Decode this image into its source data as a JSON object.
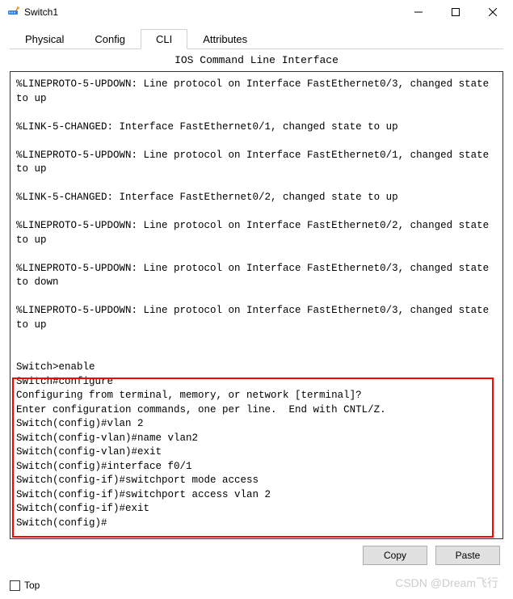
{
  "window": {
    "title": "Switch1"
  },
  "tabs": {
    "items": [
      {
        "label": "Physical"
      },
      {
        "label": "Config"
      },
      {
        "label": "CLI"
      },
      {
        "label": "Attributes"
      }
    ],
    "active_index": 2
  },
  "panel": {
    "title": "IOS Command Line Interface"
  },
  "terminal": {
    "text": "%LINEPROTO-5-UPDOWN: Line protocol on Interface FastEthernet0/3, changed state to up\n\n%LINK-5-CHANGED: Interface FastEthernet0/1, changed state to up\n\n%LINEPROTO-5-UPDOWN: Line protocol on Interface FastEthernet0/1, changed state to up\n\n%LINK-5-CHANGED: Interface FastEthernet0/2, changed state to up\n\n%LINEPROTO-5-UPDOWN: Line protocol on Interface FastEthernet0/2, changed state to up\n\n%LINEPROTO-5-UPDOWN: Line protocol on Interface FastEthernet0/3, changed state to down\n\n%LINEPROTO-5-UPDOWN: Line protocol on Interface FastEthernet0/3, changed state to up\n\n\nSwitch>enable\nSwitch#configure\nConfiguring from terminal, memory, or network [terminal]?\nEnter configuration commands, one per line.  End with CNTL/Z.\nSwitch(config)#vlan 2\nSwitch(config-vlan)#name vlan2\nSwitch(config-vlan)#exit\nSwitch(config)#interface f0/1\nSwitch(config-if)#switchport mode access\nSwitch(config-if)#switchport access vlan 2\nSwitch(config-if)#exit\nSwitch(config)#"
  },
  "buttons": {
    "copy": "Copy",
    "paste": "Paste"
  },
  "footer": {
    "checkbox_label": "Top",
    "checked": false
  },
  "watermark": "CSDN @Dream飞行"
}
